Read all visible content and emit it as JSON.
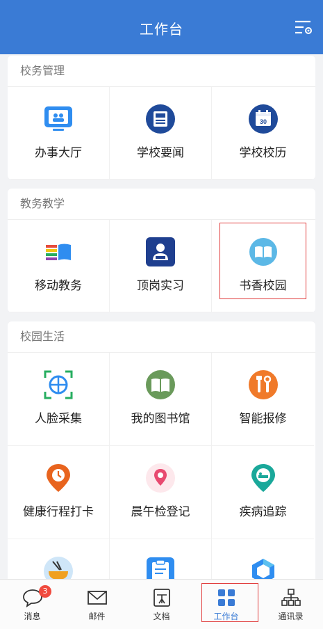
{
  "header": {
    "title": "工作台"
  },
  "sections": {
    "school_affairs": {
      "title": "校务管理",
      "items": [
        "办事大厅",
        "学校要闻",
        "学校校历"
      ]
    },
    "teaching": {
      "title": "教务教学",
      "items": [
        "移动教务",
        "顶岗实习",
        "书香校园"
      ]
    },
    "campus_life": {
      "title": "校园生活",
      "items": [
        "人脸采集",
        "我的图书馆",
        "智能报修",
        "健康行程打卡",
        "晨午检登记",
        "疾病追踪"
      ]
    }
  },
  "calendar_icon_text": "30",
  "tabbar": {
    "messages": {
      "label": "消息",
      "badge": "3"
    },
    "mail": {
      "label": "邮件"
    },
    "docs": {
      "label": "文档"
    },
    "workbench": {
      "label": "工作台"
    },
    "contacts": {
      "label": "通讯录"
    }
  },
  "colors": {
    "header": "#3a7bd5",
    "highlight": "#e03a3a",
    "badge": "#f04a3e"
  }
}
